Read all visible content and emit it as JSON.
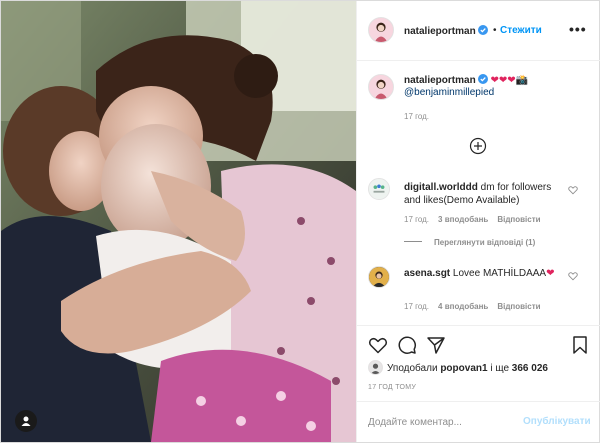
{
  "header": {
    "username": "natalieportman",
    "separator": "•",
    "follow_label": "Стежити",
    "more_label": "•••"
  },
  "caption": {
    "username": "natalieportman",
    "hearts": "❤❤❤",
    "camera": "📸",
    "mention": "@benjaminmillepied",
    "time": "17 год."
  },
  "load_more_icon": "plus-circle-icon",
  "comments": [
    {
      "username": "digitall.worlddd",
      "text": "dm for followers and likes(Demo Available)",
      "time": "17 год.",
      "likes": "3 вподобань",
      "reply": "Відповісти",
      "view_replies": "Переглянути відповіді (1)"
    },
    {
      "username": "asena.sgt",
      "text": "Lovee MATHİLDAAA",
      "hearts": "❤",
      "time": "17 год.",
      "likes": "4 вподобань",
      "reply": "Відповісти"
    }
  ],
  "actions": {
    "like_icon": "heart-icon",
    "comment_icon": "comment-icon",
    "share_icon": "paper-plane-icon",
    "save_icon": "bookmark-icon"
  },
  "likes": {
    "prefix": "Уподобали ",
    "user": "popovan1",
    "middle": " і ще ",
    "count": "366 026"
  },
  "post_time": "17 ГОД ТОМУ",
  "add_comment": {
    "placeholder": "Додайте коментар...",
    "publish_label": "Опублікувати"
  },
  "colors": {
    "accent": "#0095f6",
    "publish_disabled": "#b2dffc",
    "heart": "#e0245e",
    "muted": "#8e8e8e"
  }
}
